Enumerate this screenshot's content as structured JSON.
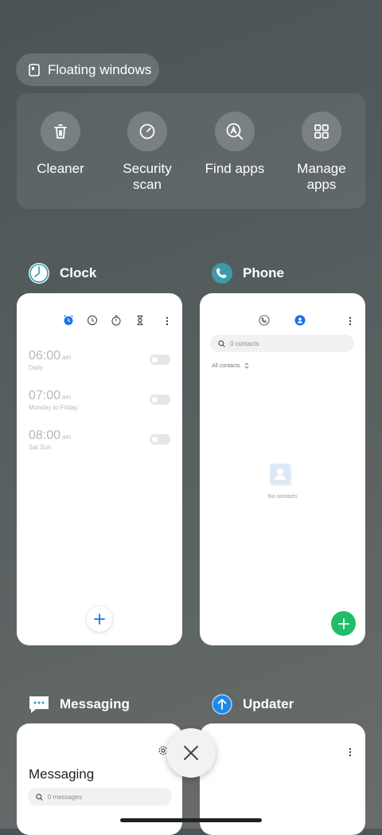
{
  "floating_windows": {
    "label": "Floating windows"
  },
  "tools": [
    {
      "label": "Cleaner",
      "icon": "trash-icon"
    },
    {
      "label": "Security\nscan",
      "icon": "security-scan-icon"
    },
    {
      "label": "Find apps",
      "icon": "find-apps-icon"
    },
    {
      "label": "Manage\napps",
      "icon": "grid-icon"
    }
  ],
  "apps": {
    "clock": {
      "name": "Clock",
      "alarms": [
        {
          "time": "06:00",
          "ampm": "am",
          "days": "Daily"
        },
        {
          "time": "07:00",
          "ampm": "am",
          "days": "Monday to Friday"
        },
        {
          "time": "08:00",
          "ampm": "am",
          "days": "Sat Sun"
        }
      ]
    },
    "phone": {
      "name": "Phone",
      "search_placeholder": "0 contacts",
      "filter_label": "All contacts",
      "empty_label": "No contacts"
    },
    "messaging": {
      "name": "Messaging",
      "title": "Messaging",
      "search_placeholder": "0 messages"
    },
    "updater": {
      "name": "Updater"
    }
  },
  "colors": {
    "accent_blue": "#1a73e8",
    "fab_green": "#1fbe6a",
    "phone_icon": "#3f9aa8",
    "updater_icon": "#1e88e5"
  }
}
